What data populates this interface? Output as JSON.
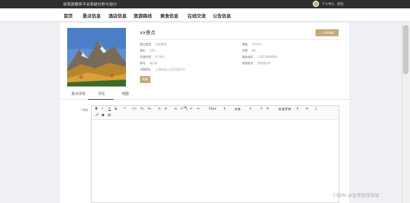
{
  "topbar": {
    "site_title": "自驾游服务平台系统分析与设计",
    "user_center": "个人中心",
    "logout": "退出"
  },
  "nav": [
    "首页",
    "景点信息",
    "酒店信息",
    "旅游路线",
    "美食信息",
    "在线交流",
    "公告信息"
  ],
  "detail": {
    "title": "xx景点",
    "collect_label": "点我收藏",
    "fields": [
      {
        "k": "景点类型",
        "v": "自然景观"
      },
      {
        "k": "等级",
        "v": "AAAAA"
      },
      {
        "k": "票价",
        "v": "258"
      },
      {
        "k": "余票",
        "v": "88"
      },
      {
        "k": "开放时间",
        "v": "8-18点"
      },
      {
        "k": "服务电话",
        "v": "13823888888"
      },
      {
        "k": "帐号",
        "v": "帐号8"
      },
      {
        "k": "商家姓名",
        "v": "商家姓名8"
      },
      {
        "k": "详细地址",
        "v": "上海市松江大区A段102"
      }
    ],
    "buy_label": "购票"
  },
  "tabs": [
    "景点详情",
    "评论",
    "地图"
  ],
  "comment": {
    "label": "评论",
    "toolbar": [
      "B",
      "I",
      "U",
      "S",
      "❝",
      "<>",
      "H₁",
      "H₂",
      "≡",
      "≡",
      "x₂",
      "x²",
      "⇤",
      "⇥",
      "14px",
      "文本",
      "A",
      "A̶",
      "标准字体",
      "≡",
      "I̲",
      "🔗",
      "▣",
      "▤"
    ]
  },
  "watermark": "CSDN @全传程序毕设"
}
